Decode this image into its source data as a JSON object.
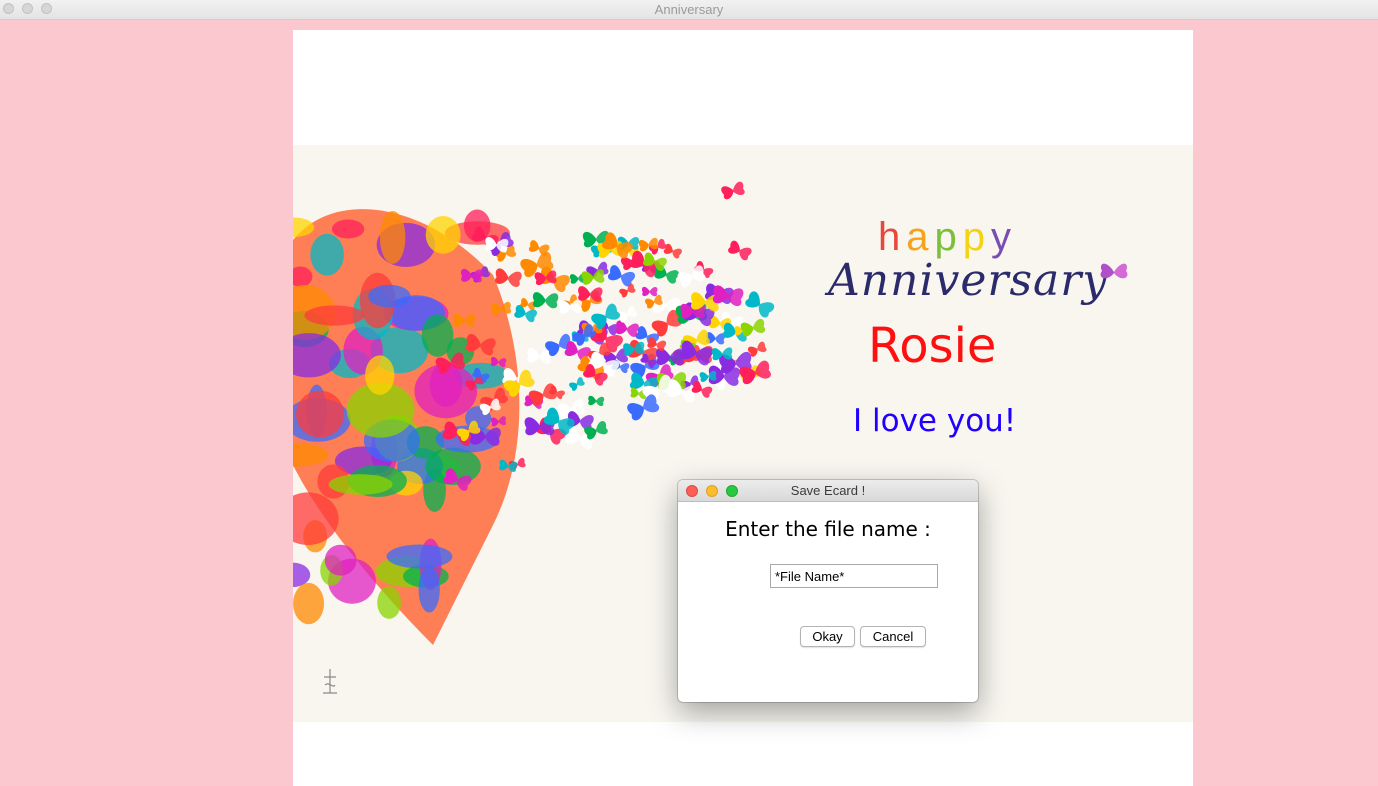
{
  "window": {
    "title": "Anniversary"
  },
  "card": {
    "happy_letters": [
      {
        "ch": "h",
        "color": "#e8483b"
      },
      {
        "ch": "a",
        "color": "#f6a21b"
      },
      {
        "ch": "p",
        "color": "#7bbf3b"
      },
      {
        "ch": "p",
        "color": "#f5d214"
      },
      {
        "ch": "y",
        "color": "#7a4db5"
      }
    ],
    "anniversary_text": "Anniversary",
    "name": "Rosie",
    "message": "I love you!"
  },
  "dialog": {
    "title": "Save Ecard !",
    "prompt": "Enter the file name :",
    "file_name_value": "*File Name*",
    "okay_label": "Okay",
    "cancel_label": "Cancel"
  },
  "colors": {
    "background": "#fbc8d0",
    "name_color": "#ff1010",
    "message_color": "#2000ff"
  }
}
